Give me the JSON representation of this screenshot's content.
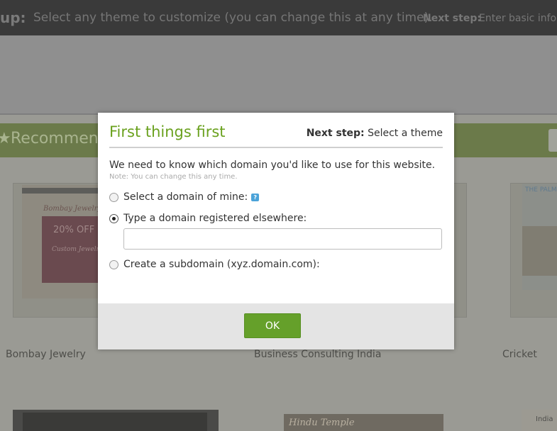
{
  "top_bar": {
    "step_title": "up:",
    "step_desc": "Select any theme to customize (you can change this at any time).",
    "next_label": "Next step:",
    "next_desc": "Enter basic infor"
  },
  "recommended_bar": {
    "title": "Recommend"
  },
  "themes": [
    {
      "name": "Bombay Jewelry",
      "banner_title": "Bombay Jewelry C",
      "banner_offer": "20% OFF",
      "banner_sub": "Custom Jewelry"
    },
    {
      "name": "Business Consulting India"
    },
    {
      "name": "Cricket",
      "banner_title": "THE PALM"
    }
  ],
  "bottom_row": [
    {
      "label": ""
    },
    {
      "label": "Hindu Temple"
    },
    {
      "label": "India"
    }
  ],
  "modal": {
    "title": "First things first",
    "next_label": "Next step:",
    "next_value": "Select a theme",
    "question": "We need to know which domain you'd like to use for this website.",
    "note": "Note: You can change this any time.",
    "options": [
      {
        "label": "Select a domain of mine:",
        "checked": false
      },
      {
        "label": "Type a domain registered elsewhere:",
        "checked": true
      },
      {
        "label": "Create a subdomain (xyz.domain.com):",
        "checked": false
      }
    ],
    "domain_input": {
      "value": "",
      "placeholder": ""
    },
    "ok_label": "OK"
  },
  "colors": {
    "accent_green": "#6aa11e",
    "button_green": "#65a02a",
    "help_icon_blue": "#4ba3d9"
  }
}
